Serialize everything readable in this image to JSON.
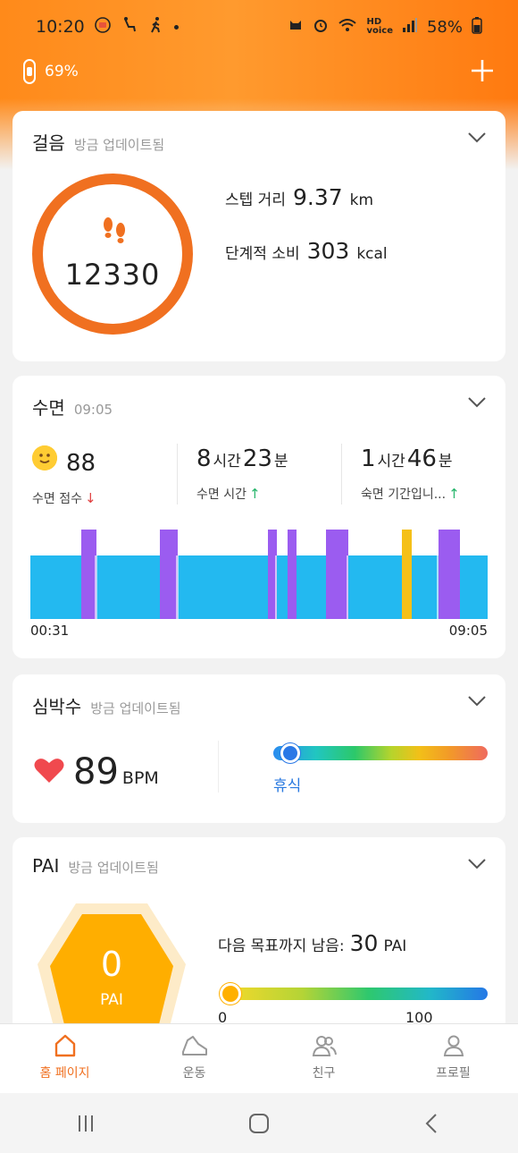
{
  "status_bar": {
    "time": "10:20",
    "battery": "58%",
    "icons": [
      "mi-app-icon",
      "seat-icon",
      "walk-icon",
      "dot",
      "cat-icon",
      "alarm-icon",
      "wifi-icon",
      "hd-voice-icon",
      "signal-icon",
      "battery-icon"
    ]
  },
  "device": {
    "battery": "69%"
  },
  "steps": {
    "title": "걸음",
    "subtitle": "방금 업데이트됨",
    "count": "12330",
    "distance_label": "스텝 거리",
    "distance_value": "9.37",
    "distance_unit": "km",
    "calorie_label": "단계적 소비",
    "calorie_value": "303",
    "calorie_unit": "kcal",
    "ring_color": "#f07020"
  },
  "sleep": {
    "title": "수면",
    "subtitle": "09:05",
    "score_value": "88",
    "score_label": "수면 점수",
    "score_trend": "↓",
    "duration_hours": "8",
    "duration_hours_unit": "시간",
    "duration_minutes": "23",
    "duration_minutes_unit": "분",
    "duration_label": "수면 시간",
    "duration_trend": "↑",
    "deep_hours": "1",
    "deep_hours_unit": "시간",
    "deep_minutes": "46",
    "deep_minutes_unit": "분",
    "deep_label": "숙면 기간입니...",
    "deep_trend": "↑",
    "start_time": "00:31",
    "end_time": "09:05",
    "colors": {
      "light": "#23b9f0",
      "rem": "#9b5cf0",
      "awake": "#f5c018"
    }
  },
  "heart": {
    "title": "심박수",
    "subtitle": "방금 업데이트됨",
    "value": "89",
    "unit": "BPM",
    "zone_label": "휴식",
    "zone_level": 0.08
  },
  "pai": {
    "title": "PAI",
    "subtitle": "방금 업데이트됨",
    "value": "0",
    "label": "PAI",
    "goal_label": "다음 목표까지 남음:",
    "goal_value": "30",
    "goal_unit": "PAI",
    "min": "0",
    "max": "100",
    "level": 0
  },
  "nav": {
    "items": [
      {
        "label": "홈 페이지",
        "icon": "home-icon",
        "active": true
      },
      {
        "label": "운동",
        "icon": "shoe-icon",
        "active": false
      },
      {
        "label": "친구",
        "icon": "friends-icon",
        "active": false
      },
      {
        "label": "프로필",
        "icon": "profile-icon",
        "active": false
      }
    ]
  }
}
